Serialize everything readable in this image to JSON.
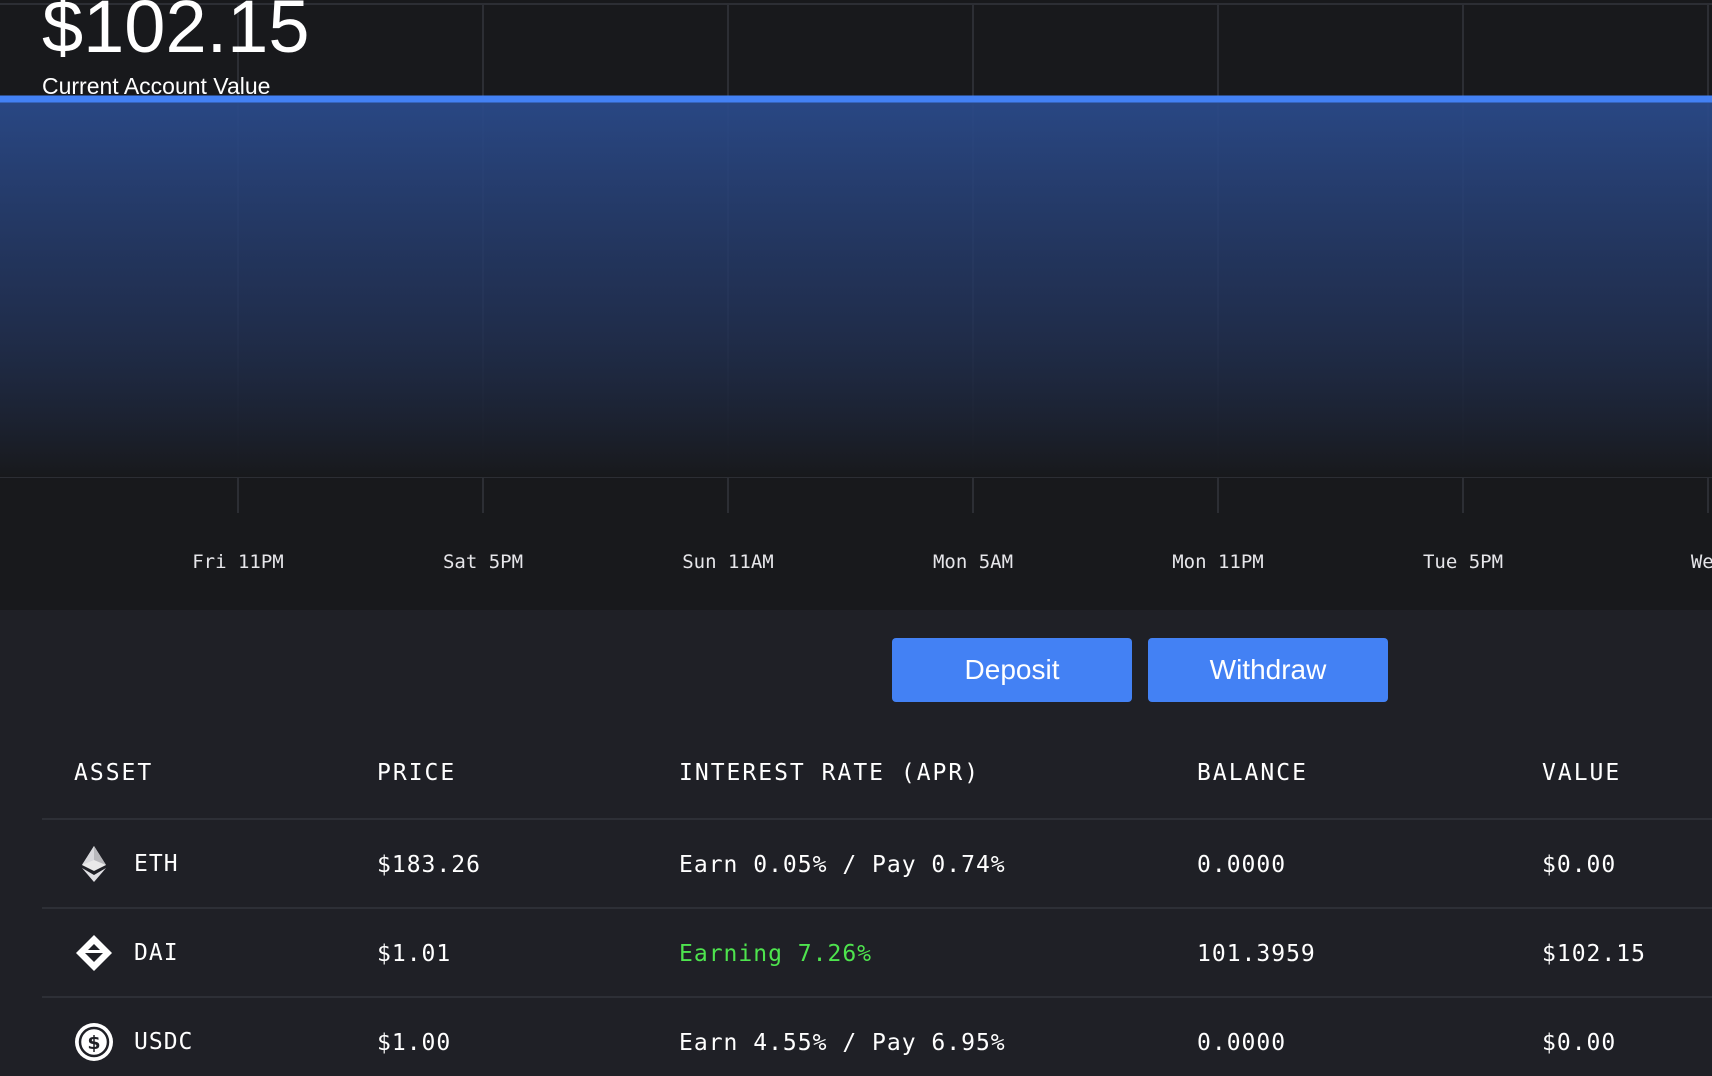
{
  "account": {
    "value": "$102.15",
    "label": "Current Account Value"
  },
  "chart_data": {
    "type": "area",
    "x": [
      "Fri 11PM",
      "Sat 5PM",
      "Sun 11AM",
      "Mon 5AM",
      "Mon 11PM",
      "Tue 5PM",
      "Wed"
    ],
    "series": [
      {
        "values": [
          102.15,
          102.15,
          102.15,
          102.15,
          102.15,
          102.15,
          102.15
        ]
      }
    ],
    "xlabel": "",
    "ylabel": "",
    "grid": true,
    "line_color": "#4381f4",
    "fill_color": "#2a4a8a"
  },
  "actions": {
    "deposit_label": "Deposit",
    "withdraw_label": "Withdraw"
  },
  "table": {
    "headers": {
      "asset": "ASSET",
      "price": "PRICE",
      "rate": "INTEREST RATE (APR)",
      "balance": "BALANCE",
      "value": "VALUE"
    },
    "rows": [
      {
        "asset": "ETH",
        "icon": "eth-icon",
        "price": "$183.26",
        "rate": "Earn 0.05% / Pay 0.74%",
        "balance": "0.0000",
        "value": "$0.00"
      },
      {
        "asset": "DAI",
        "icon": "dai-icon",
        "price": "$1.01",
        "rate": "Earning 7.26%",
        "balance": "101.3959",
        "value": "$102.15"
      },
      {
        "asset": "USDC",
        "icon": "usdc-icon",
        "price": "$1.00",
        "rate": "Earn 4.55% / Pay 6.95%",
        "balance": "0.0000",
        "value": "$0.00"
      }
    ]
  },
  "colors": {
    "accent": "#4381f4",
    "earning": "#4ee44e",
    "background": "#1f2026",
    "chart_background": "#18191c"
  }
}
